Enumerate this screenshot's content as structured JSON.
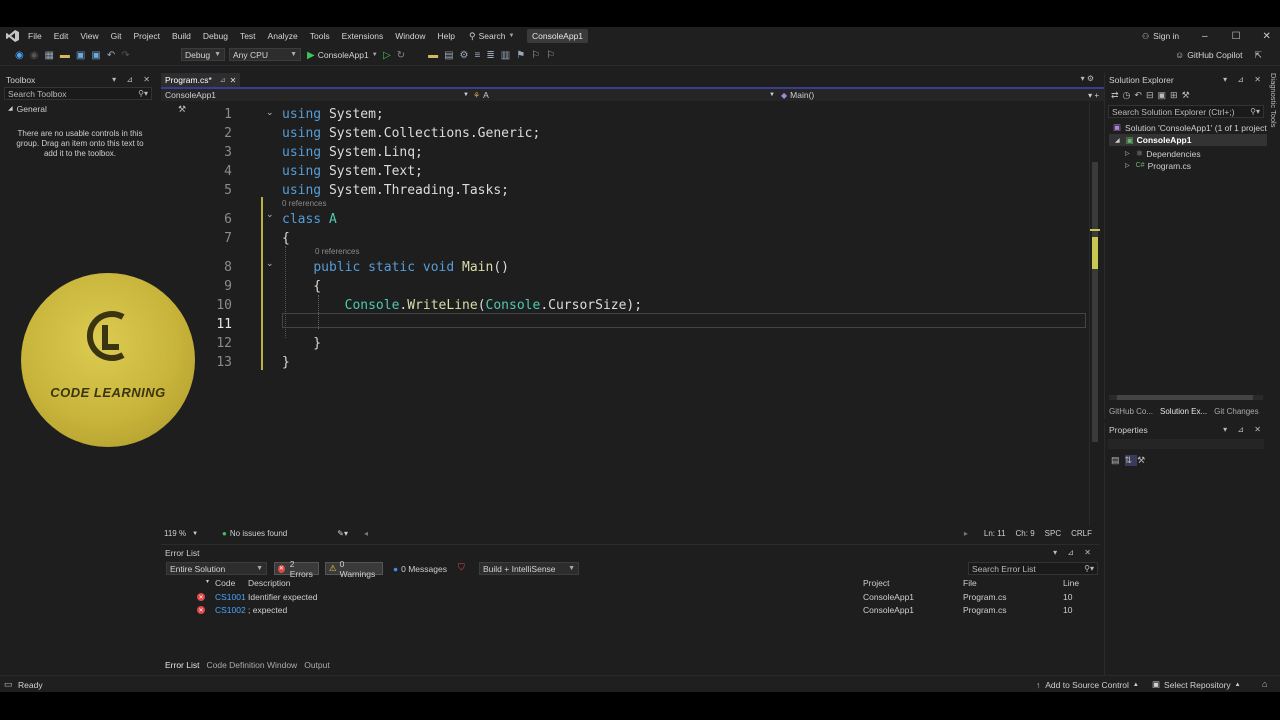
{
  "menu": [
    "File",
    "Edit",
    "View",
    "Git",
    "Project",
    "Build",
    "Debug",
    "Test",
    "Analyze",
    "Tools",
    "Extensions",
    "Window",
    "Help"
  ],
  "search_label": "Search",
  "solution_badge": "ConsoleApp1",
  "sign_in": "Sign in",
  "copilot": "GitHub Copilot",
  "toolbar": {
    "config": "Debug",
    "platform": "Any CPU",
    "start": "ConsoleApp1"
  },
  "toolbox": {
    "title": "Toolbox",
    "search_placeholder": "Search Toolbox",
    "group": "General",
    "empty_message": "There are no usable controls in this group. Drag an item onto this text to add it to the toolbox."
  },
  "editor": {
    "tab": "Program.cs*",
    "nav": {
      "project": "ConsoleApp1",
      "type": "A",
      "member": "Main()"
    },
    "references": "0 references",
    "lines": [
      {
        "n": "1",
        "tokens": [
          {
            "t": "using",
            "c": "kw"
          },
          {
            "t": " System;",
            "c": ""
          }
        ]
      },
      {
        "n": "2",
        "tokens": [
          {
            "t": "using",
            "c": "kw"
          },
          {
            "t": " System.Collections.Generic;",
            "c": ""
          }
        ]
      },
      {
        "n": "3",
        "tokens": [
          {
            "t": "using",
            "c": "kw"
          },
          {
            "t": " System.Linq;",
            "c": ""
          }
        ]
      },
      {
        "n": "4",
        "tokens": [
          {
            "t": "using",
            "c": "kw"
          },
          {
            "t": " System.Text;",
            "c": ""
          }
        ]
      },
      {
        "n": "5",
        "tokens": [
          {
            "t": "using",
            "c": "kw"
          },
          {
            "t": " System.Threading.Tasks;",
            "c": ""
          }
        ]
      },
      {
        "n": "6",
        "tokens": [
          {
            "t": "class",
            "c": "kw"
          },
          {
            "t": " ",
            "c": ""
          },
          {
            "t": "A",
            "c": "cls"
          }
        ]
      },
      {
        "n": "7",
        "tokens": [
          {
            "t": "{",
            "c": ""
          }
        ]
      },
      {
        "n": "8",
        "tokens": [
          {
            "t": "    ",
            "c": ""
          },
          {
            "t": "public static void",
            "c": "kw"
          },
          {
            "t": " ",
            "c": ""
          },
          {
            "t": "Main",
            "c": "mth"
          },
          {
            "t": "()",
            "c": ""
          }
        ]
      },
      {
        "n": "9",
        "tokens": [
          {
            "t": "    {",
            "c": ""
          }
        ]
      },
      {
        "n": "10",
        "tokens": [
          {
            "t": "        ",
            "c": ""
          },
          {
            "t": "Console",
            "c": "cls"
          },
          {
            "t": ".",
            "c": ""
          },
          {
            "t": "WriteLine",
            "c": "mth"
          },
          {
            "t": "(",
            "c": ""
          },
          {
            "t": "Console",
            "c": "cls"
          },
          {
            "t": ".CursorSize);",
            "c": ""
          }
        ]
      },
      {
        "n": "11",
        "tokens": []
      },
      {
        "n": "12",
        "tokens": [
          {
            "t": "    }",
            "c": ""
          }
        ]
      },
      {
        "n": "13",
        "tokens": [
          {
            "t": "}",
            "c": ""
          }
        ]
      }
    ],
    "status": {
      "zoom": "119 %",
      "issues": "No issues found",
      "ln": "Ln: 11",
      "ch": "Ch: 9",
      "spc": "SPC",
      "crlf": "CRLF"
    }
  },
  "watermark": {
    "text": "CODE LEARNING"
  },
  "solution_explorer": {
    "title": "Solution Explorer",
    "search_placeholder": "Search Solution Explorer (Ctrl+;)",
    "solution": "Solution 'ConsoleApp1' (1 of 1 project",
    "project": "ConsoleApp1",
    "items": [
      "Dependencies",
      "Program.cs"
    ],
    "tabs": [
      "GitHub Co...",
      "Solution Ex...",
      "Git Changes"
    ],
    "side_label": "Diagnostic Tools"
  },
  "properties": {
    "title": "Properties"
  },
  "error_list": {
    "title": "Error List",
    "scope": "Entire Solution",
    "errors_btn": "2 Errors",
    "warnings_btn": "0 Warnings",
    "messages_btn": "0 Messages",
    "build_filter": "Build + IntelliSense",
    "search_placeholder": "Search Error List",
    "columns": {
      "code": "Code",
      "description": "Description",
      "project": "Project",
      "file": "File",
      "line": "Line"
    },
    "rows": [
      {
        "code": "CS1001",
        "description": "Identifier expected",
        "project": "ConsoleApp1",
        "file": "Program.cs",
        "line": "10"
      },
      {
        "code": "CS1002",
        "description": "; expected",
        "project": "ConsoleApp1",
        "file": "Program.cs",
        "line": "10"
      }
    ]
  },
  "bottom_tabs": [
    "Error List",
    "Code Definition Window",
    "Output"
  ],
  "statusbar": {
    "ready": "Ready",
    "source_control": "Add to Source Control",
    "repository": "Select Repository"
  }
}
